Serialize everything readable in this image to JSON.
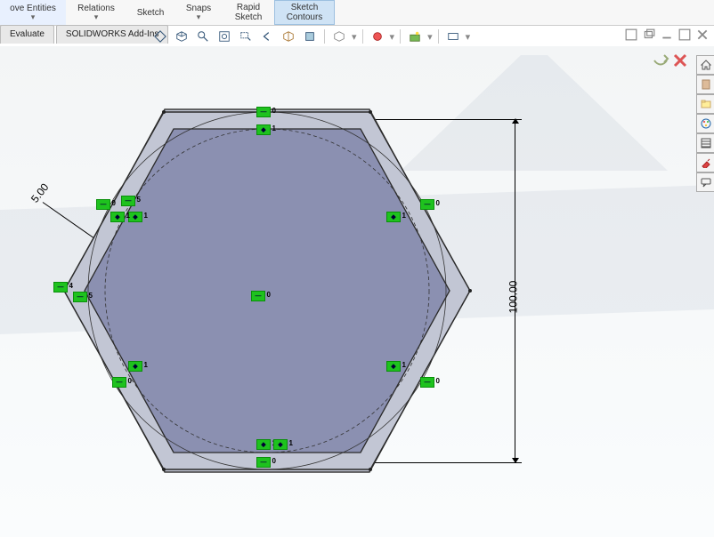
{
  "ribbon": {
    "move_entities": "ove Entities",
    "relations": "Relations",
    "sketch": "Sketch",
    "snaps": "Snaps",
    "rapid_sketch": "Rapid\nSketch",
    "sketch_contours": "Sketch\nContours"
  },
  "tabs": {
    "evaluate": "Evaluate",
    "addins": "SOLIDWORKS Add-Ins"
  },
  "dimensions": {
    "height": "100.00",
    "offset": "5.00"
  },
  "relations": {
    "hv": "=",
    "tan": "◆"
  },
  "icons": {
    "orient": "orient-icon",
    "box": "box-icon",
    "zoom": "zoom-icon",
    "zoomfit": "zoom-fit-icon",
    "pan": "pan-icon",
    "section": "section-icon",
    "style": "display-style-icon",
    "scene": "scene-icon",
    "hide": "hide-show-icon",
    "appear": "appearance-icon",
    "render": "render-icon",
    "screen": "screen-icon"
  }
}
